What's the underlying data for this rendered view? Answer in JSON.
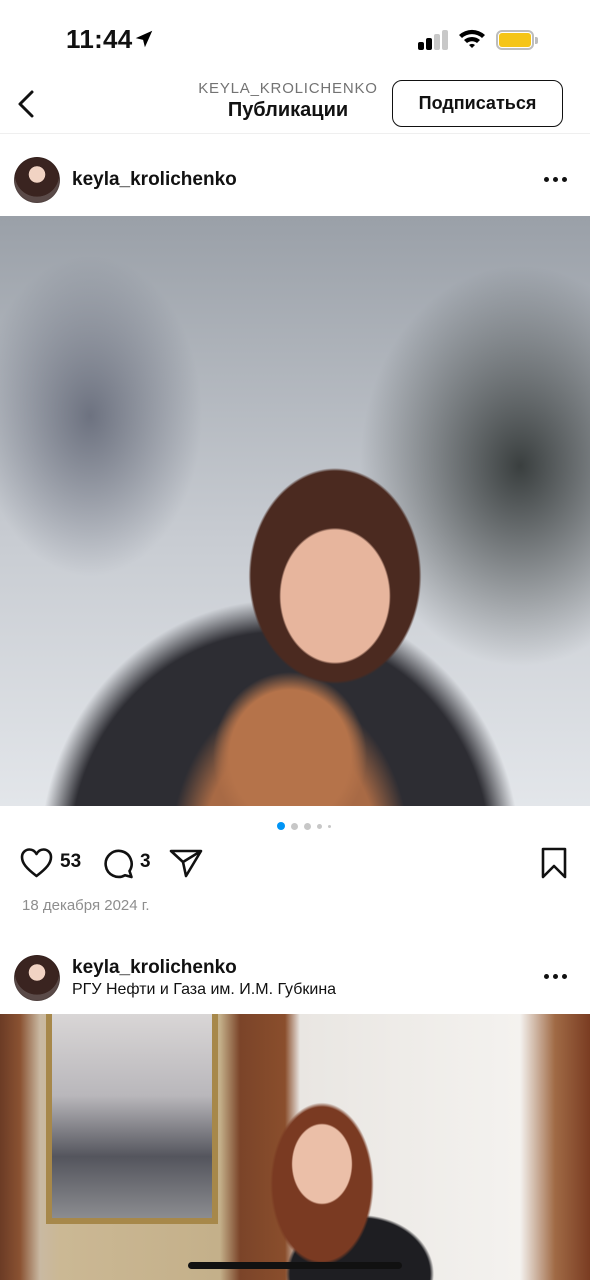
{
  "status_bar": {
    "time": "11:44",
    "accent_battery": "#f5c518"
  },
  "nav": {
    "account": "KEYLA_KROLICHENKO",
    "title": "Публикации",
    "follow_label": "Подписаться"
  },
  "posts": [
    {
      "username": "keyla_krolichenko",
      "location": "",
      "likes": "53",
      "comments": "3",
      "date": "18 декабря 2024 г.",
      "carousel": {
        "count": 5,
        "active": 1
      }
    },
    {
      "username": "keyla_krolichenko",
      "location": "РГУ Нефти и Газа им. И.М. Губкина"
    }
  ],
  "icons": [
    "back-chevron-icon",
    "location-arrow-icon",
    "signal-icon",
    "wifi-icon",
    "battery-icon",
    "more-icon",
    "heart-icon",
    "comment-icon",
    "share-icon",
    "bookmark-icon"
  ],
  "colors": {
    "pager_active": "#0095f6",
    "pager_inactive": "#c7c7c7",
    "date": "#8e8e8e"
  }
}
